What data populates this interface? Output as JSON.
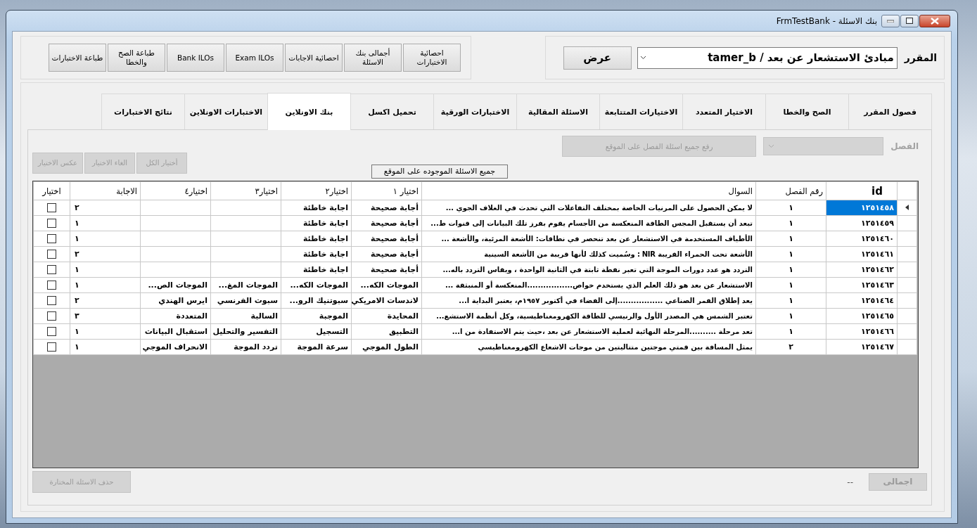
{
  "window": {
    "title": "بنك الاسئلة - FrmTestBank"
  },
  "toolbar_buttons": [
    {
      "label": "احصائية الاختبارات"
    },
    {
      "label": "أجمالى بنك الاسئلة"
    },
    {
      "label": "احصائية الاجابات"
    },
    {
      "label": "Exam ILOs"
    },
    {
      "label": "Bank ILOs"
    },
    {
      "label": "طباعة الصح والخطا"
    },
    {
      "label": "طباعة الاختبارات"
    }
  ],
  "course": {
    "label": "المقرر",
    "value": "مبادئ الاستشعار عن بعد / tamer_b",
    "show_button": "عرض"
  },
  "tabs": [
    {
      "label": "فصول المقرر",
      "selected": false
    },
    {
      "label": "الصح والخطا",
      "selected": false
    },
    {
      "label": "الاختيار المتعدد",
      "selected": false
    },
    {
      "label": "الاختيارات المتتابعة",
      "selected": false
    },
    {
      "label": "الاسئلة المقالية",
      "selected": false
    },
    {
      "label": "الاختبارات الورقية",
      "selected": false
    },
    {
      "label": "تحميل اكسل",
      "selected": false
    },
    {
      "label": "بنك الاونلاين",
      "selected": true
    },
    {
      "label": "الاختبارات الاونلاين",
      "selected": false
    },
    {
      "label": "نتائج الاختبارات",
      "selected": false
    }
  ],
  "chapter_filter": {
    "label": "الفصل",
    "disabled": true,
    "upload_button": {
      "label": "رفع جميع اسئلة الفصل على الموقع",
      "disabled": true
    }
  },
  "all_online_button": {
    "label": "جميع الاسئلة الموجوده على الموقع",
    "disabled": false
  },
  "selection_buttons": [
    {
      "label": "أختيار الكل",
      "disabled": true
    },
    {
      "label": "الغاء الاختيار",
      "disabled": true
    },
    {
      "label": "عكس الاختيار",
      "disabled": true
    }
  ],
  "table": {
    "columns": [
      "id",
      "رقم الفصل",
      "السوال",
      "اختيار ١",
      "اختيار٢",
      "اختيار٣",
      "اختيار٤",
      "الاجابة",
      "اختيار"
    ],
    "rows": [
      {
        "id": "١٢٥١٤٥٨",
        "chapter": "١",
        "question": "لا  يمكن الحصول على المرنيات الخاصة بمختلف التفاعلات التي تحدث في الغلاف الجوي ...",
        "options": [
          "أجابة صحيحة",
          "اجابة خاطئة"
        ],
        "answer": "٢",
        "selected": true,
        "checked": false
      },
      {
        "id": "١٢٥١٤٥٩",
        "chapter": "١",
        "question": "تبعد أن يستقبل المجس الطاقة المنعكسة من الأجسام يقوم بفرز تلك البيانات إلى قنوات ط...",
        "options": [
          "أجابة صحيحة",
          "اجابة خاطئة"
        ],
        "answer": "١",
        "selected": false,
        "checked": false
      },
      {
        "id": "١٢٥١٤٦٠",
        "chapter": "١",
        "question": "الأطياف المستخدمة في الاستشعار عن بعد تنحصر في نطاقات: الأشعة المرئية، والأشعة ...",
        "options": [
          "أجابة صحيحة",
          "اجابة خاطئة"
        ],
        "answer": "١",
        "selected": false,
        "checked": false
      },
      {
        "id": "١٢٥١٤٦١",
        "chapter": "١",
        "question": "الأشعة تحت الحمراء القريبة NIR :  وسُميت كذلك لأنها قريبة من الأشعة السينية",
        "options": [
          "أجابة صحيحة",
          "اجابة خاطئة"
        ],
        "answer": "٢",
        "selected": false,
        "checked": false
      },
      {
        "id": "١٢٥١٤٦٢",
        "chapter": "١",
        "question": "التردد هو عدد دورات الموجة التي تعبر نقطة ثابتة في الثانية الواحدة ، ويقاس التردد باله...",
        "options": [
          "أجابة صحيحة",
          "اجابة خاطئة"
        ],
        "answer": "١",
        "selected": false,
        "checked": false
      },
      {
        "id": "١٢٥١٤٦٣",
        "chapter": "١",
        "question": "الاستشعار عن بعد هو ذلك العلم الذي يستخدم خواص.................المنعكسة أو المنبثقة ...",
        "options": [
          "الموجات الكه...",
          "الموجات الكه...",
          "الموجات المغ...",
          "الموجات الص..."
        ],
        "answer": "١",
        "selected": false,
        "checked": false
      },
      {
        "id": "١٢٥١٤٦٤",
        "chapter": "١",
        "question": "يعد إطلاق القمر الصناعي .................إلى الفضاء في أكتوبر ١٩٥٧م، يعتبر البداية ا...",
        "options": [
          "لاندسات الامريكي",
          "سبوتنيك  الرو...",
          "سبوت الفرنسي",
          "ايرس الهندي"
        ],
        "answer": "٢",
        "selected": false,
        "checked": false
      },
      {
        "id": "١٢٥١٤٦٥",
        "chapter": "١",
        "question": "تعتبر الشمس هي المصدر الأول والرنيسي للطاقة الكهرومغناطيسية، وكل أنظمة الاستشع...",
        "options": [
          "المحايدة",
          "الموجبة",
          "السالبة",
          "المتعددة"
        ],
        "answer": "٣",
        "selected": false,
        "checked": false
      },
      {
        "id": "١٢٥١٤٦٦",
        "chapter": "١",
        "question": "تعد مرحلة ..........المرحلة النهائية لعملية الاستشعار عن بعد ،حيث يتم الاستفادة من ا...",
        "options": [
          "التطبيق",
          "التسجيل",
          "التفسير والتحليل",
          "استقبال البيانات"
        ],
        "answer": "١",
        "selected": false,
        "checked": false
      },
      {
        "id": "١٢٥١٤٦٧",
        "chapter": "٢",
        "question": "يمثل المسافة بين قمتي موجتين متتاليتين من موجات الاشعاع الكهرومغناطيسي",
        "options": [
          "الطول الموجي",
          "سرعة الموجة",
          "تردد الموجة",
          "الانحراف الموجي"
        ],
        "answer": "١",
        "selected": false,
        "checked": false
      }
    ]
  },
  "footer": {
    "delete_button": {
      "label": "حذف الاسئلة المختارة",
      "disabled": true
    },
    "total_button": {
      "label": "اجمالى",
      "disabled": true
    },
    "total_value": "--"
  }
}
